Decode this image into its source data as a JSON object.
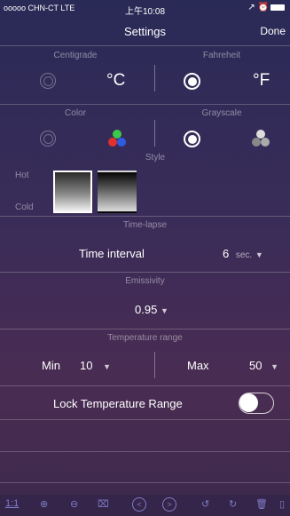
{
  "status_bar": {
    "carrier": "ooooo CHN-CT LTE",
    "time": "上午10:08",
    "right_icons": "↗ ⏰"
  },
  "nav": {
    "title": "Settings",
    "done": "Done"
  },
  "units": {
    "centigrade_label": "Centigrade",
    "fahrenheit_label": "Fahreheit",
    "celsius_symbol": "°C",
    "fahrenheit_symbol": "°F",
    "selected": "fahrenheit"
  },
  "palette": {
    "color_label": "Color",
    "grayscale_label": "Grayscale",
    "selected": "grayscale"
  },
  "style": {
    "label": "Style",
    "hot": "Hot",
    "cold": "Cold"
  },
  "timelapse": {
    "section_label": "Time-lapse",
    "interval_label": "Time interval",
    "interval_value": "6",
    "interval_unit": "sec."
  },
  "emissivity": {
    "section_label": "Emissivity",
    "value": "0.95"
  },
  "temp_range": {
    "section_label": "Temperature range",
    "min_label": "Min",
    "min_value": "10",
    "max_label": "Max",
    "max_value": "50"
  },
  "lock": {
    "label": "Lock Temperature Range",
    "enabled": false
  },
  "toolbar": {
    "one_to_one": "1:1"
  }
}
